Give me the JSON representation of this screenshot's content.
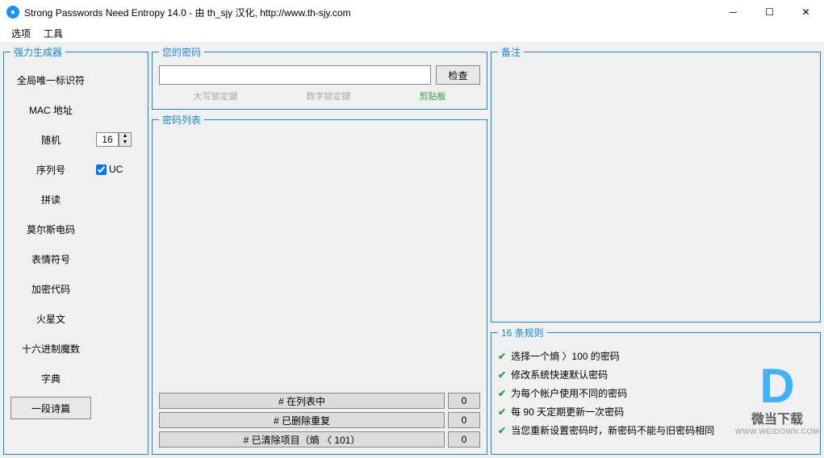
{
  "window": {
    "title": "Strong Passwords Need Entropy 14.0 - 由 th_sjy 汉化, http://www.th-sjy.com"
  },
  "menu": {
    "options": "选项",
    "tools": "工具"
  },
  "generators": {
    "legend": "强力生成器",
    "items": {
      "guid": "全局唯一标识符",
      "mac": "MAC 地址",
      "random": "随机",
      "serial": "序列号",
      "pinyin": "拼读",
      "morse": "莫尔斯电码",
      "emoji": "表情符号",
      "crypto": "加密代码",
      "martian": "火星文",
      "hex": "十六进制魔数",
      "dict": "字典",
      "poem": "一段诗篇"
    },
    "random_len": "16",
    "uc_label": "UC"
  },
  "password": {
    "legend": "您的密码",
    "check": "检查",
    "caps": "大写锁定键",
    "num": "数字锁定键",
    "clipboard": "剪贴板"
  },
  "list": {
    "legend": "密码列表",
    "in_list": "# 在列表中",
    "in_list_val": "0",
    "dup_removed": "# 已删除重复",
    "dup_removed_val": "0",
    "cleared": "# 已清除项目（熵 〈 101）",
    "cleared_val": "0"
  },
  "notes": {
    "legend": "备注"
  },
  "rules": {
    "legend": "16 条规则",
    "items": [
      "选择一个熵 〉100 的密码",
      "修改系统快速默认密码",
      "为每个帐户使用不同的密码",
      "每 90 天定期更新一次密码",
      "当您重新设置密码时，新密码不能与旧密码相同"
    ]
  },
  "watermark": {
    "ch": "微当下载",
    "url": "WWW.WEIDOWN.COM"
  }
}
